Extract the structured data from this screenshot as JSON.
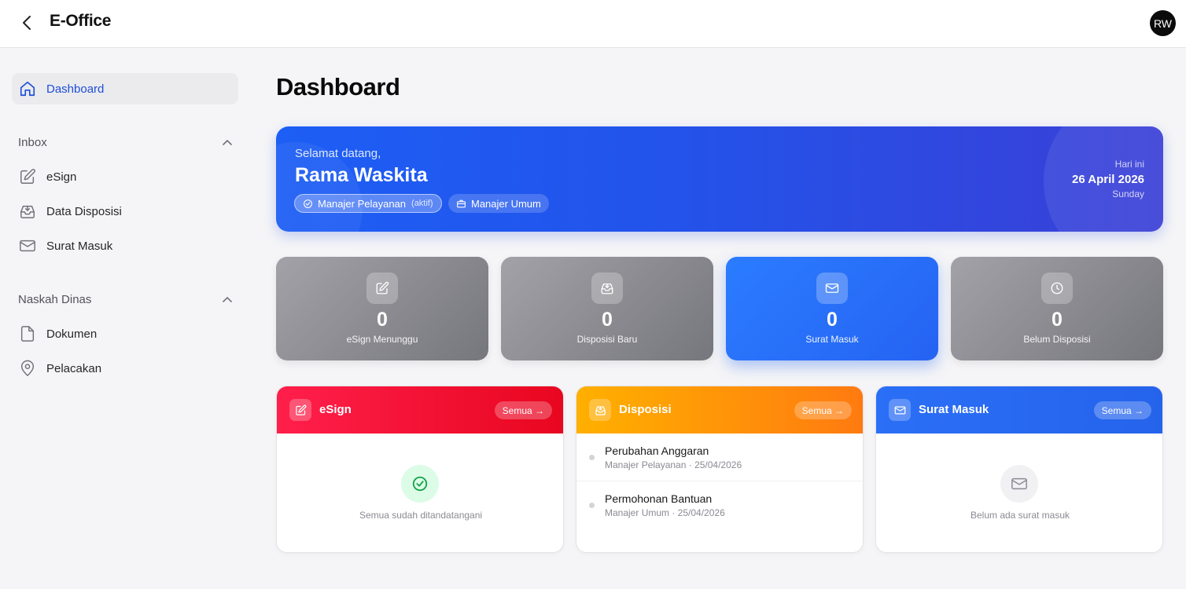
{
  "app": {
    "title": "E-Office",
    "user_initials": "RW"
  },
  "sidebar": {
    "dashboard": {
      "label": "Dashboard"
    },
    "inbox": {
      "title": "Inbox",
      "items": [
        {
          "label": "eSign",
          "icon": "edit-icon"
        },
        {
          "label": "Data Disposisi",
          "icon": "inbox-icon"
        },
        {
          "label": "Surat Masuk",
          "icon": "mail-icon"
        }
      ]
    },
    "naskah": {
      "title": "Naskah Dinas",
      "items": [
        {
          "label": "Dokumen",
          "icon": "file-icon"
        },
        {
          "label": "Pelacakan",
          "icon": "map-pin-icon"
        }
      ]
    }
  },
  "main": {
    "title": "Dashboard",
    "hero": {
      "greeting": "Selamat datang,",
      "name": "Rama Waskita",
      "roles": [
        {
          "label": "Manajer Pelayanan",
          "badge": "(aktif)"
        },
        {
          "label": "Manajer Umum"
        }
      ],
      "today_label": "Hari ini",
      "date": "26 April 2026",
      "day": "Sunday"
    },
    "stats": [
      {
        "value": "0",
        "label": "eSign Menunggu",
        "icon": "edit-icon"
      },
      {
        "value": "0",
        "label": "Disposisi Baru",
        "icon": "inbox-icon"
      },
      {
        "value": "0",
        "label": "Surat Masuk",
        "icon": "mail-icon"
      },
      {
        "value": "0",
        "label": "Belum Disposisi",
        "icon": "clock-icon"
      }
    ],
    "panels": {
      "esign": {
        "title": "eSign",
        "all_label": "Semua →",
        "empty_text": "Semua sudah ditandatangani"
      },
      "disposisi": {
        "title": "Disposisi",
        "all_label": "Semua →",
        "items": [
          {
            "title": "Perubahan Anggaran",
            "meta": "Manajer Pelayanan · 25/04/2026"
          },
          {
            "title": "Permohonan Bantuan",
            "meta": "Manajer Umum · 25/04/2026"
          }
        ]
      },
      "surat": {
        "title": "Surat Masuk",
        "all_label": "Semua →",
        "empty_text": "Belum ada surat masuk"
      }
    }
  },
  "colors": {
    "accent": "#2563eb",
    "esign_header": "#f0103a",
    "disposisi_header": "#ff9a05",
    "surat_header": "#2563eb",
    "success": "#16a34a"
  }
}
